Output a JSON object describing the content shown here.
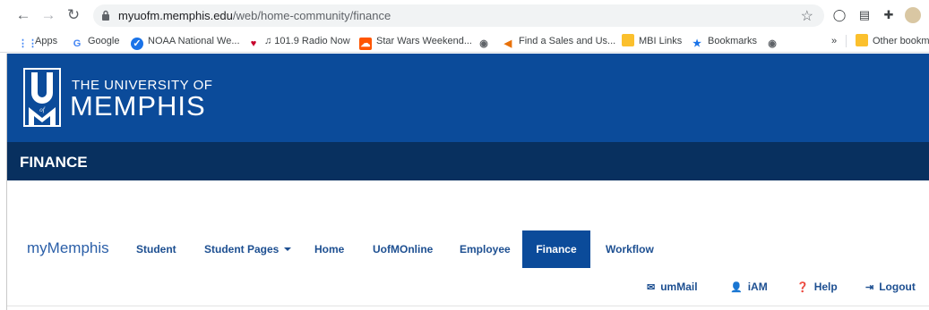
{
  "browser": {
    "url_host": "myuofm.memphis.edu",
    "url_path": "/web/home-community/finance",
    "back_icon": "←",
    "forward_icon": "→",
    "reload_icon": "↻",
    "star_icon": "☆"
  },
  "bookmarks": [
    {
      "label": "Apps",
      "icon": "apps-grid-icon",
      "color": "#4285f4"
    },
    {
      "label": "Google",
      "icon": "google-g-icon",
      "color": "#4285f4"
    },
    {
      "label": "NOAA National We...",
      "icon": "noaa-icon",
      "color": "#1a73e8"
    },
    {
      "label": "♫ 101.9 Radio Now",
      "icon": "iheart-icon",
      "color": "#c6002b"
    },
    {
      "label": "Star Wars Weekend...",
      "icon": "soundcloud-icon",
      "color": "#ff5500"
    },
    {
      "label": "",
      "icon": "globe-icon",
      "color": "#5f6368"
    },
    {
      "label": "Find a Sales and Us...",
      "icon": "flag-icon",
      "color": "#e8710a"
    },
    {
      "label": "MBI Links",
      "icon": "folder-icon",
      "color": "#fbc02d"
    },
    {
      "label": "Bookmarks",
      "icon": "star-icon",
      "color": "#1a73e8"
    },
    {
      "label": "",
      "icon": "globe-icon",
      "color": "#5f6368"
    }
  ],
  "bookmarks_overflow": "»",
  "bookmarks_other": "Other bookm",
  "site": {
    "logo_line1": "THE UNIVERSITY OF",
    "logo_line2": "MEMPHIS",
    "logo_mark": "U of M",
    "section_title": "FINANCE",
    "brand_link": "myMemphis",
    "nav": [
      "Student",
      "Student Pages",
      "Home",
      "UofMOnline",
      "Employee",
      "Finance",
      "Workflow"
    ],
    "active_nav": "Finance",
    "utility": [
      {
        "label": "umMail",
        "icon": "envelope-icon"
      },
      {
        "label": "iAM",
        "icon": "user-icon"
      },
      {
        "label": "Help",
        "icon": "question-circle-icon"
      },
      {
        "label": "Logout",
        "icon": "sign-out-icon"
      }
    ]
  },
  "colors": {
    "brand_blue": "#0b4b9a",
    "section_navy": "#08305f",
    "nav_text": "#1d4f91"
  }
}
